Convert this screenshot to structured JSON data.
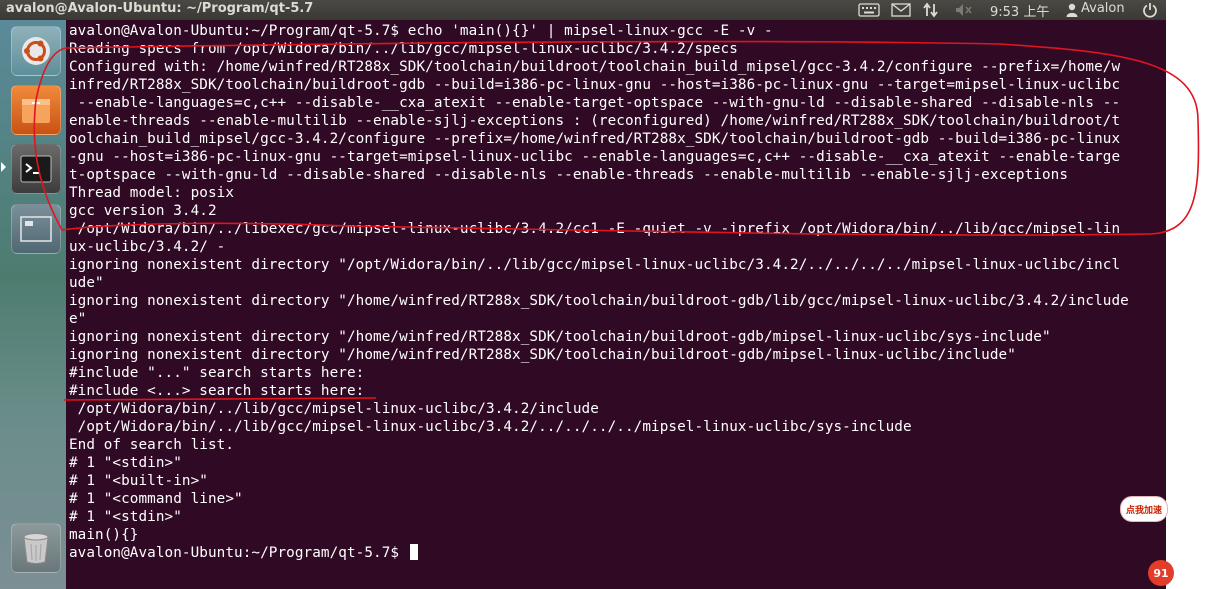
{
  "panel": {
    "window_title": "avalon@Avalon-Ubuntu: ~/Program/qt-5.7",
    "clock": "9:53 上午",
    "user": "Avalon",
    "tray_icons": [
      "keyboard-icon",
      "mail-icon",
      "network-icon",
      "volume-icon",
      "user-icon",
      "power-icon"
    ]
  },
  "launcher": {
    "items": [
      {
        "name": "ubuntu-dash-icon"
      },
      {
        "name": "files-icon"
      },
      {
        "name": "terminal-icon"
      },
      {
        "name": "workspace-switcher-icon"
      },
      {
        "name": "trash-icon"
      }
    ]
  },
  "terminal": {
    "lines": [
      "avalon@Avalon-Ubuntu:~/Program/qt-5.7$ echo 'main(){}' | mipsel-linux-gcc -E -v -",
      "Reading specs from /opt/Widora/bin/../lib/gcc/mipsel-linux-uclibc/3.4.2/specs",
      "Configured with: /home/winfred/RT288x_SDK/toolchain/buildroot/toolchain_build_mipsel/gcc-3.4.2/configure --prefix=/home/w",
      "infred/RT288x_SDK/toolchain/buildroot-gdb --build=i386-pc-linux-gnu --host=i386-pc-linux-gnu --target=mipsel-linux-uclibc",
      " --enable-languages=c,c++ --disable-__cxa_atexit --enable-target-optspace --with-gnu-ld --disable-shared --disable-nls --",
      "enable-threads --enable-multilib --enable-sjlj-exceptions : (reconfigured) /home/winfred/RT288x_SDK/toolchain/buildroot/t",
      "oolchain_build_mipsel/gcc-3.4.2/configure --prefix=/home/winfred/RT288x_SDK/toolchain/buildroot-gdb --build=i386-pc-linux",
      "-gnu --host=i386-pc-linux-gnu --target=mipsel-linux-uclibc --enable-languages=c,c++ --disable-__cxa_atexit --enable-targe",
      "t-optspace --with-gnu-ld --disable-shared --disable-nls --enable-threads --enable-multilib --enable-sjlj-exceptions",
      "Thread model: posix",
      "gcc version 3.4.2",
      " /opt/Widora/bin/../libexec/gcc/mipsel-linux-uclibc/3.4.2/cc1 -E -quiet -v -iprefix /opt/Widora/bin/../lib/gcc/mipsel-lin",
      "ux-uclibc/3.4.2/ -",
      "ignoring nonexistent directory \"/opt/Widora/bin/../lib/gcc/mipsel-linux-uclibc/3.4.2/../../../../mipsel-linux-uclibc/incl",
      "ude\"",
      "ignoring nonexistent directory \"/home/winfred/RT288x_SDK/toolchain/buildroot-gdb/lib/gcc/mipsel-linux-uclibc/3.4.2/include",
      "e\"",
      "ignoring nonexistent directory \"/home/winfred/RT288x_SDK/toolchain/buildroot-gdb/mipsel-linux-uclibc/sys-include\"",
      "ignoring nonexistent directory \"/home/winfred/RT288x_SDK/toolchain/buildroot-gdb/mipsel-linux-uclibc/include\"",
      "#include \"...\" search starts here:",
      "#include <...> search starts here:",
      " /opt/Widora/bin/../lib/gcc/mipsel-linux-uclibc/3.4.2/include",
      " /opt/Widora/bin/../lib/gcc/mipsel-linux-uclibc/3.4.2/../../../../mipsel-linux-uclibc/sys-include",
      "End of search list.",
      "# 1 \"<stdin>\"",
      "# 1 \"<built-in>\"",
      "# 1 \"<command line>\"",
      "# 1 \"<stdin>\"",
      "main(){}"
    ],
    "prompt": "avalon@Avalon-Ubuntu:~/Program/qt-5.7$ "
  },
  "overlay": {
    "promo_badge": "点我加速",
    "promo_number": "91"
  },
  "colors": {
    "terminal_bg": "#300a24",
    "terminal_fg": "#ffffff",
    "annotation": "#e0141e"
  }
}
